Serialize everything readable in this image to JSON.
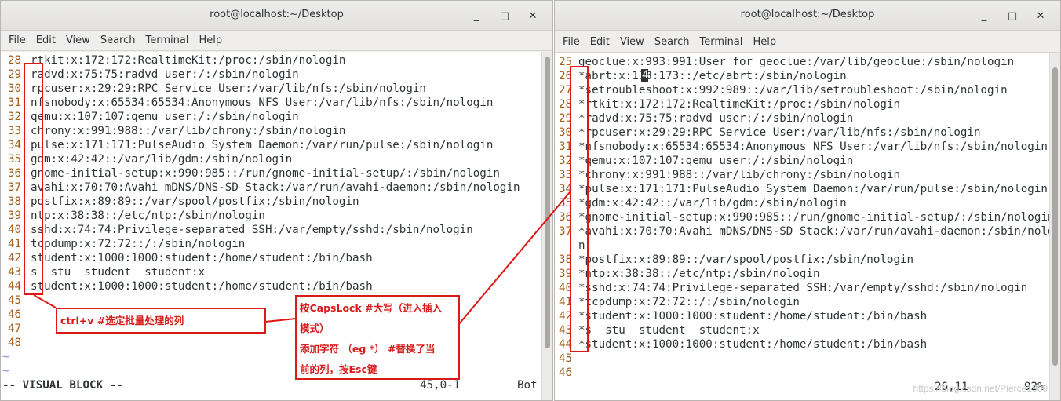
{
  "left_window": {
    "title": "root@localhost:~/Desktop",
    "controls": [
      "_",
      "□",
      "✕"
    ],
    "menu": [
      "File",
      "Edit",
      "View",
      "Search",
      "Terminal",
      "Help"
    ],
    "lines": [
      {
        "n": "28",
        "t": "rtkit:x:172:172:RealtimeKit:/proc:/sbin/nologin"
      },
      {
        "n": "29",
        "t": "radvd:x:75:75:radvd user:/:/sbin/nologin"
      },
      {
        "n": "30",
        "t": "rpcuser:x:29:29:RPC Service User:/var/lib/nfs:/sbin/nologin"
      },
      {
        "n": "31",
        "t": "nfsnobody:x:65534:65534:Anonymous NFS User:/var/lib/nfs:/sbin/nologin"
      },
      {
        "n": "32",
        "t": "qemu:x:107:107:qemu user:/:/sbin/nologin"
      },
      {
        "n": "33",
        "t": "chrony:x:991:988::/var/lib/chrony:/sbin/nologin"
      },
      {
        "n": "34",
        "t": "pulse:x:171:171:PulseAudio System Daemon:/var/run/pulse:/sbin/nologin"
      },
      {
        "n": "35",
        "t": "gdm:x:42:42::/var/lib/gdm:/sbin/nologin"
      },
      {
        "n": "36",
        "t": "gnome-initial-setup:x:990:985::/run/gnome-initial-setup/:/sbin/nologin"
      },
      {
        "n": "37",
        "t": "avahi:x:70:70:Avahi mDNS/DNS-SD Stack:/var/run/avahi-daemon:/sbin/nologin"
      },
      {
        "n": "38",
        "t": "postfix:x:89:89::/var/spool/postfix:/sbin/nologin"
      },
      {
        "n": "39",
        "t": "ntp:x:38:38::/etc/ntp:/sbin/nologin"
      },
      {
        "n": "40",
        "t": "sshd:x:74:74:Privilege-separated SSH:/var/empty/sshd:/sbin/nologin"
      },
      {
        "n": "41",
        "t": "tcpdump:x:72:72::/:/sbin/nologin"
      },
      {
        "n": "42",
        "t": "student:x:1000:1000:student:/home/student:/bin/bash"
      },
      {
        "n": "43",
        "t": "s  stu  student  student:x"
      },
      {
        "n": "44",
        "t": "student:x:1000:1000:student:/home/student:/bin/bash"
      },
      {
        "n": "45",
        "t": ""
      },
      {
        "n": "46",
        "t": ""
      },
      {
        "n": "47",
        "t": ""
      },
      {
        "n": "48",
        "t": ""
      }
    ],
    "tildes": [
      "~",
      "~"
    ],
    "status_mode": "-- VISUAL BLOCK --",
    "status_pos": "45,0-1",
    "status_scroll": "Bot"
  },
  "right_window": {
    "title": "root@localhost:~/Desktop",
    "controls": [
      "_",
      "□",
      "✕"
    ],
    "menu": [
      "File",
      "Edit",
      "View",
      "Search",
      "Terminal",
      "Help"
    ],
    "lines": [
      {
        "n": "25",
        "t": "geoclue:x:993:991:User for geoclue:/var/lib/geoclue:/sbin/nologin"
      },
      {
        "n": "26",
        "t": "*abrt:x:173:173::/etc/abrt:/sbin/nologin"
      },
      {
        "n": "27",
        "t": "*setroubleshoot:x:992:989::/var/lib/setroubleshoot:/sbin/nologin"
      },
      {
        "n": "28",
        "t": "*rtkit:x:172:172:RealtimeKit:/proc:/sbin/nologin"
      },
      {
        "n": "29",
        "t": "*radvd:x:75:75:radvd user:/:/sbin/nologin"
      },
      {
        "n": "30",
        "t": "*rpcuser:x:29:29:RPC Service User:/var/lib/nfs:/sbin/nologin"
      },
      {
        "n": "31",
        "t": "*nfsnobody:x:65534:65534:Anonymous NFS User:/var/lib/nfs:/sbin/nologin"
      },
      {
        "n": "32",
        "t": "*qemu:x:107:107:qemu user:/:/sbin/nologin"
      },
      {
        "n": "33",
        "t": "*chrony:x:991:988::/var/lib/chrony:/sbin/nologin"
      },
      {
        "n": "34",
        "t": "*pulse:x:171:171:PulseAudio System Daemon:/var/run/pulse:/sbin/nologin"
      },
      {
        "n": "35",
        "t": "*gdm:x:42:42::/var/lib/gdm:/sbin/nologin"
      },
      {
        "n": "36",
        "t": "*gnome-initial-setup:x:990:985::/run/gnome-initial-setup/:/sbin/nologin"
      },
      {
        "n": "37",
        "t": "*avahi:x:70:70:Avahi mDNS/DNS-SD Stack:/var/run/avahi-daemon:/sbin/nologi"
      },
      {
        "n": "",
        "t": "n"
      },
      {
        "n": "38",
        "t": "*postfix:x:89:89::/var/spool/postfix:/sbin/nologin"
      },
      {
        "n": "39",
        "t": "*ntp:x:38:38::/etc/ntp:/sbin/nologin"
      },
      {
        "n": "40",
        "t": "*sshd:x:74:74:Privilege-separated SSH:/var/empty/sshd:/sbin/nologin"
      },
      {
        "n": "41",
        "t": "*tcpdump:x:72:72::/:/sbin/nologin"
      },
      {
        "n": "42",
        "t": "*student:x:1000:1000:student:/home/student:/bin/bash"
      },
      {
        "n": "43",
        "t": "*s  stu  student  student:x"
      },
      {
        "n": "44",
        "t": "*student:x:1000:1000:student:/home/student:/bin/bash"
      },
      {
        "n": "45",
        "t": ""
      },
      {
        "n": "46",
        "t": ""
      }
    ],
    "cursor_char": "4",
    "status_pos": "26,11",
    "status_scroll": "92%"
  },
  "annotations": {
    "note1": "ctrl+v #选定批量处理的列",
    "note2_line1": "按CapsLock #大写（进入插入",
    "note2_line2": "模式）",
    "note3_line1": "添加字符  （eg *） #替换了当",
    "note3_line2": "前的列，按Esc键"
  },
  "watermark": "https://blog.csdn.net/Pierce1900"
}
